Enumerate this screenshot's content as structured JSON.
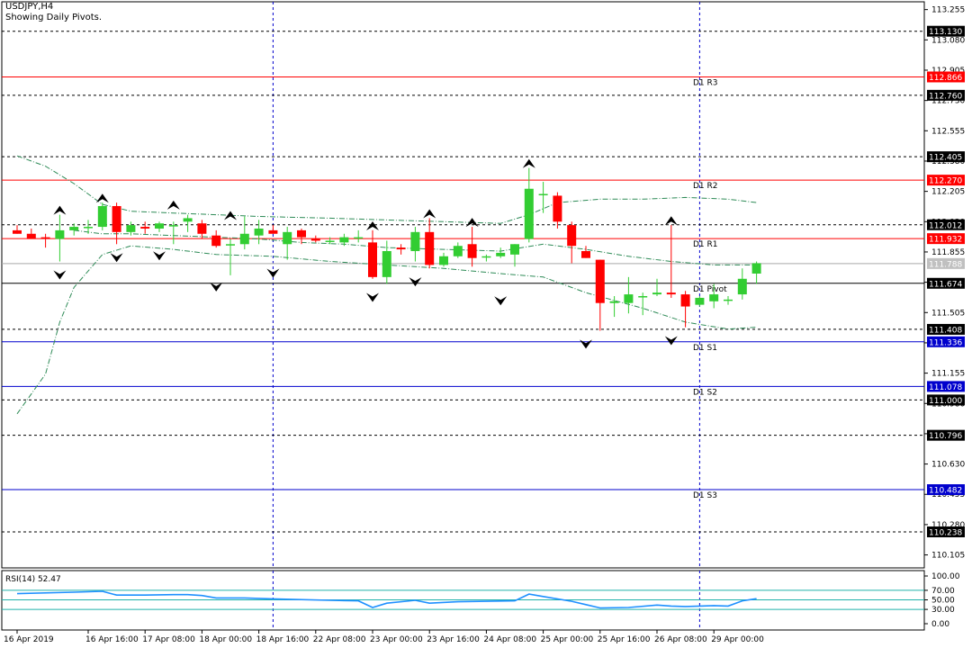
{
  "header": {
    "symbol": "USDJPY,H4",
    "subtitle": "Showing Daily Pivots."
  },
  "colors": {
    "bull": "#32cd32",
    "bear": "#ff0000",
    "ma": "#2e8b57",
    "pivot_resistance": "#ff0000",
    "pivot_support": "#0000cd",
    "pivot_main": "#000000",
    "dotted": "#000000",
    "vgrid": "#0000cd",
    "rsi": "#1e90ff",
    "rsi_levels": "#20b2aa",
    "current_price_bg": "#c0c0c0"
  },
  "chart_data": [
    {
      "type": "candlestick",
      "symbol": "USDJPY",
      "timeframe": "H4",
      "ylim": [
        110.0,
        113.3
      ],
      "y_ticks": [
        "113.255",
        "113.080",
        "112.905",
        "112.730",
        "112.555",
        "112.380",
        "112.205",
        "112.030",
        "111.855",
        "111.680",
        "111.505",
        "111.330",
        "111.155",
        "110.980",
        "110.805",
        "110.630",
        "110.455",
        "110.280",
        "110.105"
      ],
      "x_labels": [
        {
          "label": "16 Apr 2019",
          "index": 0
        },
        {
          "label": "16 Apr 16:00",
          "index": 5
        },
        {
          "label": "17 Apr 08:00",
          "index": 9
        },
        {
          "label": "18 Apr 00:00",
          "index": 13
        },
        {
          "label": "18 Apr 16:00",
          "index": 17
        },
        {
          "label": "22 Apr 08:00",
          "index": 21
        },
        {
          "label": "23 Apr 00:00",
          "index": 25
        },
        {
          "label": "23 Apr 16:00",
          "index": 29
        },
        {
          "label": "24 Apr 08:00",
          "index": 33
        },
        {
          "label": "25 Apr 00:00",
          "index": 37
        },
        {
          "label": "25 Apr 16:00",
          "index": 41
        },
        {
          "label": "26 Apr 08:00",
          "index": 45
        },
        {
          "label": "29 Apr 00:00",
          "index": 49
        }
      ],
      "day_separators": [
        18,
        48
      ],
      "candles": [
        {
          "o": 111.98,
          "h": 112.01,
          "l": 111.96,
          "c": 111.96
        },
        {
          "o": 111.96,
          "h": 111.99,
          "l": 111.93,
          "c": 111.93
        },
        {
          "o": 111.94,
          "h": 111.96,
          "l": 111.88,
          "c": 111.93
        },
        {
          "o": 111.93,
          "h": 112.07,
          "l": 111.8,
          "c": 111.98
        },
        {
          "o": 111.98,
          "h": 112.02,
          "l": 111.95,
          "c": 112.0
        },
        {
          "o": 112.0,
          "h": 112.04,
          "l": 111.96,
          "c": 112.0
        },
        {
          "o": 112.0,
          "h": 112.14,
          "l": 111.98,
          "c": 112.12
        },
        {
          "o": 112.12,
          "h": 112.14,
          "l": 111.9,
          "c": 111.97
        },
        {
          "o": 111.97,
          "h": 112.03,
          "l": 111.95,
          "c": 112.01
        },
        {
          "o": 112.0,
          "h": 112.03,
          "l": 111.96,
          "c": 111.99
        },
        {
          "o": 111.99,
          "h": 112.03,
          "l": 111.97,
          "c": 112.02
        },
        {
          "o": 112.01,
          "h": 112.03,
          "l": 111.9,
          "c": 112.01
        },
        {
          "o": 112.03,
          "h": 112.07,
          "l": 111.97,
          "c": 112.05
        },
        {
          "o": 112.02,
          "h": 112.04,
          "l": 111.93,
          "c": 111.96
        },
        {
          "o": 111.95,
          "h": 111.98,
          "l": 111.88,
          "c": 111.89
        },
        {
          "o": 111.9,
          "h": 111.93,
          "l": 111.72,
          "c": 111.9
        },
        {
          "o": 111.9,
          "h": 112.06,
          "l": 111.87,
          "c": 111.96
        },
        {
          "o": 111.95,
          "h": 112.04,
          "l": 111.9,
          "c": 111.99
        },
        {
          "o": 111.98,
          "h": 112.01,
          "l": 111.96,
          "c": 111.96
        },
        {
          "o": 111.9,
          "h": 112.0,
          "l": 111.81,
          "c": 111.97
        },
        {
          "o": 111.98,
          "h": 111.99,
          "l": 111.9,
          "c": 111.94
        },
        {
          "o": 111.93,
          "h": 111.95,
          "l": 111.91,
          "c": 111.92
        },
        {
          "o": 111.92,
          "h": 111.94,
          "l": 111.9,
          "c": 111.92
        },
        {
          "o": 111.91,
          "h": 111.96,
          "l": 111.89,
          "c": 111.94
        },
        {
          "o": 111.94,
          "h": 111.98,
          "l": 111.91,
          "c": 111.94
        },
        {
          "o": 111.91,
          "h": 111.98,
          "l": 111.7,
          "c": 111.71
        },
        {
          "o": 111.71,
          "h": 111.92,
          "l": 111.67,
          "c": 111.86
        },
        {
          "o": 111.88,
          "h": 111.9,
          "l": 111.84,
          "c": 111.87
        },
        {
          "o": 111.86,
          "h": 112.0,
          "l": 111.8,
          "c": 111.97
        },
        {
          "o": 111.97,
          "h": 112.05,
          "l": 111.76,
          "c": 111.78
        },
        {
          "o": 111.78,
          "h": 111.85,
          "l": 111.77,
          "c": 111.83
        },
        {
          "o": 111.83,
          "h": 111.91,
          "l": 111.82,
          "c": 111.89
        },
        {
          "o": 111.9,
          "h": 112.0,
          "l": 111.77,
          "c": 111.82
        },
        {
          "o": 111.83,
          "h": 111.84,
          "l": 111.8,
          "c": 111.83
        },
        {
          "o": 111.83,
          "h": 111.88,
          "l": 111.82,
          "c": 111.85
        },
        {
          "o": 111.84,
          "h": 111.9,
          "l": 111.77,
          "c": 111.9
        },
        {
          "o": 111.93,
          "h": 112.34,
          "l": 111.91,
          "c": 112.22
        },
        {
          "o": 112.19,
          "h": 112.26,
          "l": 112.08,
          "c": 112.19
        },
        {
          "o": 112.18,
          "h": 112.2,
          "l": 111.99,
          "c": 112.03
        },
        {
          "o": 112.01,
          "h": 112.03,
          "l": 111.79,
          "c": 111.89
        },
        {
          "o": 111.86,
          "h": 111.89,
          "l": 111.82,
          "c": 111.82
        },
        {
          "o": 111.81,
          "h": 111.81,
          "l": 111.4,
          "c": 111.56
        },
        {
          "o": 111.56,
          "h": 111.6,
          "l": 111.48,
          "c": 111.57
        },
        {
          "o": 111.56,
          "h": 111.71,
          "l": 111.5,
          "c": 111.61
        },
        {
          "o": 111.6,
          "h": 111.62,
          "l": 111.49,
          "c": 111.6
        },
        {
          "o": 111.61,
          "h": 111.7,
          "l": 111.6,
          "c": 111.62
        },
        {
          "o": 111.62,
          "h": 112.01,
          "l": 111.59,
          "c": 111.61
        },
        {
          "o": 111.61,
          "h": 111.63,
          "l": 111.42,
          "c": 111.54
        },
        {
          "o": 111.55,
          "h": 111.6,
          "l": 111.54,
          "c": 111.59
        },
        {
          "o": 111.57,
          "h": 111.67,
          "l": 111.53,
          "c": 111.61
        },
        {
          "o": 111.58,
          "h": 111.6,
          "l": 111.55,
          "c": 111.58
        },
        {
          "o": 111.61,
          "h": 111.76,
          "l": 111.58,
          "c": 111.7
        },
        {
          "o": 111.73,
          "h": 111.8,
          "l": 111.67,
          "c": 111.79
        }
      ],
      "fractals_up": [
        {
          "i": 3,
          "v": 112.08
        },
        {
          "i": 6,
          "v": 112.15
        },
        {
          "i": 11,
          "v": 112.11
        },
        {
          "i": 15,
          "v": 112.05
        },
        {
          "i": 25,
          "v": 111.99
        },
        {
          "i": 29,
          "v": 112.06
        },
        {
          "i": 32,
          "v": 112.01
        },
        {
          "i": 36,
          "v": 112.35
        },
        {
          "i": 46,
          "v": 112.02
        }
      ],
      "fractals_down": [
        {
          "i": 3,
          "v": 111.79
        },
        {
          "i": 7,
          "v": 111.89
        },
        {
          "i": 10,
          "v": 111.9
        },
        {
          "i": 14,
          "v": 111.72
        },
        {
          "i": 18,
          "v": 111.8
        },
        {
          "i": 25,
          "v": 111.66
        },
        {
          "i": 28,
          "v": 111.75
        },
        {
          "i": 34,
          "v": 111.64
        },
        {
          "i": 40,
          "v": 111.39
        },
        {
          "i": 46,
          "v": 111.41
        }
      ],
      "bands_upper": [
        {
          "i": 0,
          "v": 112.41
        },
        {
          "i": 2,
          "v": 112.35
        },
        {
          "i": 4,
          "v": 112.25
        },
        {
          "i": 6,
          "v": 112.13
        },
        {
          "i": 8,
          "v": 112.09
        },
        {
          "i": 11,
          "v": 112.08
        },
        {
          "i": 14,
          "v": 112.07
        },
        {
          "i": 17,
          "v": 112.06
        },
        {
          "i": 22,
          "v": 112.05
        },
        {
          "i": 26,
          "v": 112.04
        },
        {
          "i": 30,
          "v": 112.03
        },
        {
          "i": 34,
          "v": 112.02
        },
        {
          "i": 36,
          "v": 112.07
        },
        {
          "i": 38,
          "v": 112.14
        },
        {
          "i": 41,
          "v": 112.16
        },
        {
          "i": 44,
          "v": 112.16
        },
        {
          "i": 47,
          "v": 112.17
        },
        {
          "i": 50,
          "v": 112.16
        },
        {
          "i": 52,
          "v": 112.14
        }
      ],
      "bands_middle": [
        {
          "i": 4,
          "v": 111.98
        },
        {
          "i": 6,
          "v": 111.96
        },
        {
          "i": 8,
          "v": 111.96
        },
        {
          "i": 11,
          "v": 111.95
        },
        {
          "i": 14,
          "v": 111.94
        },
        {
          "i": 17,
          "v": 111.93
        },
        {
          "i": 20,
          "v": 111.91
        },
        {
          "i": 23,
          "v": 111.9
        },
        {
          "i": 26,
          "v": 111.88
        },
        {
          "i": 30,
          "v": 111.87
        },
        {
          "i": 34,
          "v": 111.86
        },
        {
          "i": 37,
          "v": 111.9
        },
        {
          "i": 40,
          "v": 111.87
        },
        {
          "i": 43,
          "v": 111.83
        },
        {
          "i": 46,
          "v": 111.8
        },
        {
          "i": 49,
          "v": 111.78
        },
        {
          "i": 52,
          "v": 111.78
        }
      ],
      "bands_lower": [
        {
          "i": 0,
          "v": 110.92
        },
        {
          "i": 2,
          "v": 111.15
        },
        {
          "i": 3,
          "v": 111.45
        },
        {
          "i": 4,
          "v": 111.65
        },
        {
          "i": 6,
          "v": 111.84
        },
        {
          "i": 8,
          "v": 111.89
        },
        {
          "i": 11,
          "v": 111.87
        },
        {
          "i": 14,
          "v": 111.84
        },
        {
          "i": 18,
          "v": 111.83
        },
        {
          "i": 22,
          "v": 111.8
        },
        {
          "i": 26,
          "v": 111.78
        },
        {
          "i": 30,
          "v": 111.76
        },
        {
          "i": 34,
          "v": 111.73
        },
        {
          "i": 37,
          "v": 111.71
        },
        {
          "i": 40,
          "v": 111.62
        },
        {
          "i": 44,
          "v": 111.53
        },
        {
          "i": 47,
          "v": 111.45
        },
        {
          "i": 50,
          "v": 111.41
        },
        {
          "i": 52,
          "v": 111.42
        }
      ],
      "pivot_levels": [
        {
          "label": "D1 R3",
          "value": 112.866,
          "kind": "resistance",
          "price_tag": "112.866"
        },
        {
          "label": "D1 R2",
          "value": 112.27,
          "kind": "resistance",
          "price_tag": "112.270"
        },
        {
          "label": "D1 R1",
          "value": 111.932,
          "kind": "resistance",
          "price_tag": "111.932"
        },
        {
          "label": "D1 Pivot",
          "value": 111.674,
          "kind": "pivot",
          "price_tag": "111.674"
        },
        {
          "label": "D1 S1",
          "value": 111.336,
          "kind": "support",
          "price_tag": "111.336"
        },
        {
          "label": "D1 S2",
          "value": 111.078,
          "kind": "support",
          "price_tag": "111.078"
        },
        {
          "label": "D1 S3",
          "value": 110.482,
          "kind": "support",
          "price_tag": "110.482"
        }
      ],
      "dotted_levels": [
        {
          "value": 113.13,
          "price_tag": "113.130"
        },
        {
          "value": 112.76,
          "price_tag": "112.760"
        },
        {
          "value": 112.405,
          "price_tag": "112.405"
        },
        {
          "value": 112.012,
          "price_tag": "112.012"
        },
        {
          "value": 111.408,
          "price_tag": "111.408"
        },
        {
          "value": 111.0,
          "price_tag": "111.000"
        },
        {
          "value": 110.796,
          "price_tag": "110.796"
        },
        {
          "value": 110.238,
          "price_tag": "110.238"
        }
      ],
      "current_price": {
        "value": 111.788,
        "price_tag": "111.788"
      }
    },
    {
      "type": "line",
      "name": "RSI(14)",
      "title": "RSI(14) 52.47",
      "ylim": [
        0,
        100
      ],
      "y_ticks": [
        "100.00",
        "70.00",
        "50.00",
        "30.00",
        "0.00"
      ],
      "levels": [
        70,
        50,
        30
      ],
      "values": [
        {
          "i": 0,
          "v": 63
        },
        {
          "i": 4,
          "v": 66
        },
        {
          "i": 5,
          "v": 67
        },
        {
          "i": 6,
          "v": 68
        },
        {
          "i": 7,
          "v": 60
        },
        {
          "i": 9,
          "v": 60
        },
        {
          "i": 11,
          "v": 61
        },
        {
          "i": 12,
          "v": 61
        },
        {
          "i": 13,
          "v": 59
        },
        {
          "i": 14,
          "v": 54
        },
        {
          "i": 16,
          "v": 54
        },
        {
          "i": 18,
          "v": 52
        },
        {
          "i": 22,
          "v": 49
        },
        {
          "i": 24,
          "v": 48
        },
        {
          "i": 25,
          "v": 34
        },
        {
          "i": 26,
          "v": 43
        },
        {
          "i": 28,
          "v": 49
        },
        {
          "i": 29,
          "v": 43
        },
        {
          "i": 31,
          "v": 46
        },
        {
          "i": 33,
          "v": 47
        },
        {
          "i": 35,
          "v": 48
        },
        {
          "i": 36,
          "v": 62
        },
        {
          "i": 37,
          "v": 57
        },
        {
          "i": 39,
          "v": 47
        },
        {
          "i": 40,
          "v": 40
        },
        {
          "i": 41,
          "v": 33
        },
        {
          "i": 43,
          "v": 34
        },
        {
          "i": 45,
          "v": 39
        },
        {
          "i": 46,
          "v": 37
        },
        {
          "i": 47,
          "v": 36
        },
        {
          "i": 49,
          "v": 38
        },
        {
          "i": 50,
          "v": 37
        },
        {
          "i": 51,
          "v": 48
        },
        {
          "i": 52,
          "v": 52.47
        }
      ]
    }
  ]
}
